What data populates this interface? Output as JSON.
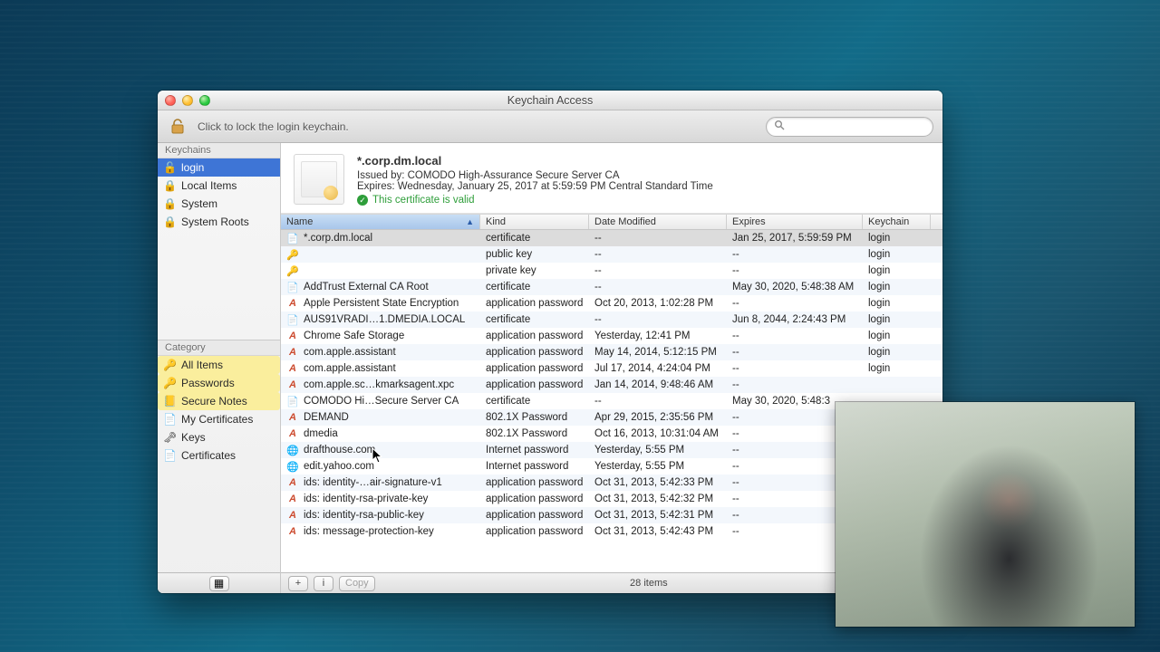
{
  "window": {
    "title": "Keychain Access"
  },
  "toolbar": {
    "lock_hint": "Click to lock the login keychain.",
    "search_placeholder": ""
  },
  "sidebar": {
    "keychains_title": "Keychains",
    "keychains": [
      {
        "label": "login",
        "icon": "🔓",
        "selected": true
      },
      {
        "label": "Local Items",
        "icon": "🔒",
        "selected": false
      },
      {
        "label": "System",
        "icon": "🔒",
        "selected": false
      },
      {
        "label": "System Roots",
        "icon": "🔒",
        "selected": false
      }
    ],
    "category_title": "Category",
    "categories": [
      {
        "label": "All Items",
        "icon": "🔑",
        "highlight": true
      },
      {
        "label": "Passwords",
        "icon": "🔑",
        "highlight": true
      },
      {
        "label": "Secure Notes",
        "icon": "📒",
        "highlight": true
      },
      {
        "label": "My Certificates",
        "icon": "📄",
        "highlight": false
      },
      {
        "label": "Keys",
        "icon": "🗝",
        "highlight": false
      },
      {
        "label": "Certificates",
        "icon": "📄",
        "highlight": false
      }
    ]
  },
  "detail": {
    "name": "*.corp.dm.local",
    "issued_by": "Issued by: COMODO High-Assurance Secure Server CA",
    "expires": "Expires: Wednesday, January 25, 2017 at 5:59:59 PM Central Standard Time",
    "valid_text": "This certificate is valid"
  },
  "columns": {
    "name": "Name",
    "kind": "Kind",
    "modified": "Date Modified",
    "expires": "Expires",
    "keychain": "Keychain"
  },
  "rows": [
    {
      "icon": "cert",
      "name": "*.corp.dm.local",
      "kind": "certificate",
      "modified": "--",
      "expires": "Jan 25, 2017, 5:59:59 PM",
      "keychain": "login",
      "selected": true
    },
    {
      "icon": "key",
      "name": "<key>",
      "kind": "public key",
      "modified": "--",
      "expires": "--",
      "keychain": "login"
    },
    {
      "icon": "key",
      "name": "<key>",
      "kind": "private key",
      "modified": "--",
      "expires": "--",
      "keychain": "login"
    },
    {
      "icon": "cert",
      "name": "AddTrust External CA Root",
      "kind": "certificate",
      "modified": "--",
      "expires": "May 30, 2020, 5:48:38 AM",
      "keychain": "login"
    },
    {
      "icon": "app",
      "name": "Apple Persistent State Encryption",
      "kind": "application password",
      "modified": "Oct 20, 2013, 1:02:28 PM",
      "expires": "--",
      "keychain": "login"
    },
    {
      "icon": "cert",
      "name": "AUS91VRADI…1.DMEDIA.LOCAL",
      "kind": "certificate",
      "modified": "--",
      "expires": "Jun 8, 2044, 2:24:43 PM",
      "keychain": "login"
    },
    {
      "icon": "app",
      "name": "Chrome Safe Storage",
      "kind": "application password",
      "modified": "Yesterday, 12:41 PM",
      "expires": "--",
      "keychain": "login"
    },
    {
      "icon": "app",
      "name": "com.apple.assistant",
      "kind": "application password",
      "modified": "May 14, 2014, 5:12:15 PM",
      "expires": "--",
      "keychain": "login"
    },
    {
      "icon": "app",
      "name": "com.apple.assistant",
      "kind": "application password",
      "modified": "Jul 17, 2014, 4:24:04 PM",
      "expires": "--",
      "keychain": "login"
    },
    {
      "icon": "app",
      "name": "com.apple.sc…kmarksagent.xpc",
      "kind": "application password",
      "modified": "Jan 14, 2014, 9:48:46 AM",
      "expires": "--",
      "keychain": ""
    },
    {
      "icon": "cert",
      "name": "COMODO Hi…Secure Server CA",
      "kind": "certificate",
      "modified": "--",
      "expires": "May 30, 2020, 5:48:3",
      "keychain": ""
    },
    {
      "icon": "app",
      "name": "DEMAND",
      "kind": "802.1X Password",
      "modified": "Apr 29, 2015, 2:35:56 PM",
      "expires": "--",
      "keychain": ""
    },
    {
      "icon": "app",
      "name": "dmedia",
      "kind": "802.1X Password",
      "modified": "Oct 16, 2013, 10:31:04 AM",
      "expires": "--",
      "keychain": ""
    },
    {
      "icon": "net",
      "name": "drafthouse.com",
      "kind": "Internet password",
      "modified": "Yesterday, 5:55 PM",
      "expires": "--",
      "keychain": ""
    },
    {
      "icon": "net",
      "name": "edit.yahoo.com",
      "kind": "Internet password",
      "modified": "Yesterday, 5:55 PM",
      "expires": "--",
      "keychain": ""
    },
    {
      "icon": "app",
      "name": "ids: identity-…air-signature-v1",
      "kind": "application password",
      "modified": "Oct 31, 2013, 5:42:33 PM",
      "expires": "--",
      "keychain": ""
    },
    {
      "icon": "app",
      "name": "ids: identity-rsa-private-key",
      "kind": "application password",
      "modified": "Oct 31, 2013, 5:42:32 PM",
      "expires": "--",
      "keychain": ""
    },
    {
      "icon": "app",
      "name": "ids: identity-rsa-public-key",
      "kind": "application password",
      "modified": "Oct 31, 2013, 5:42:31 PM",
      "expires": "--",
      "keychain": ""
    },
    {
      "icon": "app",
      "name": "ids: message-protection-key",
      "kind": "application password",
      "modified": "Oct 31, 2013, 5:42:43 PM",
      "expires": "--",
      "keychain": ""
    }
  ],
  "statusbar": {
    "add": "+",
    "info": "i",
    "copy": "Copy",
    "count": "28 items",
    "view_icon": "▦"
  }
}
